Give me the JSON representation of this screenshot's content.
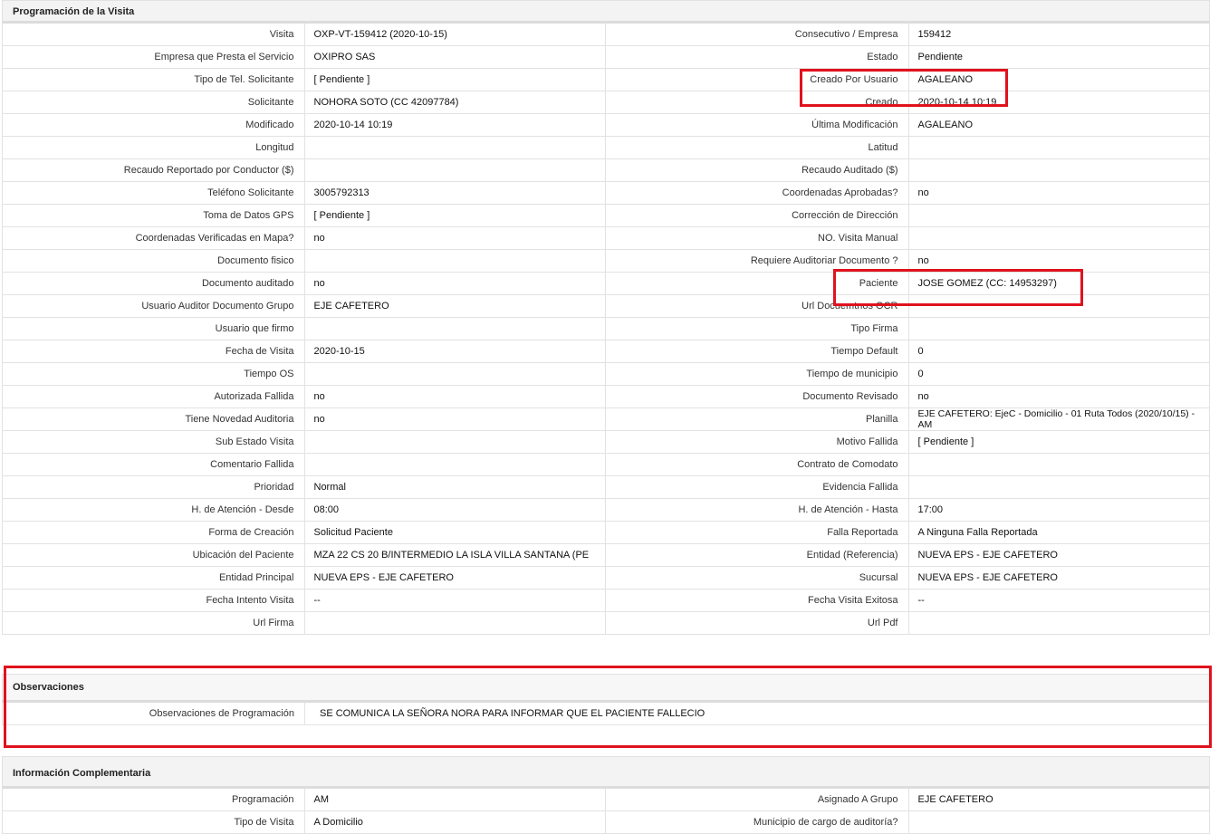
{
  "section1": {
    "title": "Programación de la Visita",
    "rows": [
      {
        "l1": "Visita",
        "v1": "OXP-VT-159412 (2020-10-15)",
        "l2": "Consecutivo / Empresa",
        "v2": "159412"
      },
      {
        "l1": "Empresa que Presta el Servicio",
        "v1": "OXIPRO SAS",
        "l2": "Estado",
        "v2": "Pendiente"
      },
      {
        "l1": "Tipo de Tel. Solicitante",
        "v1": "[ Pendiente ]",
        "l2": "Creado Por Usuario",
        "v2": "AGALEANO"
      },
      {
        "l1": "Solicitante",
        "v1": "NOHORA SOTO (CC 42097784)",
        "l2": "Creado",
        "v2": "2020-10-14 10:19"
      },
      {
        "l1": "Modificado",
        "v1": "2020-10-14 10:19",
        "l2": "Última Modificación",
        "v2": "AGALEANO"
      },
      {
        "l1": "Longitud",
        "v1": "",
        "l2": "Latitud",
        "v2": ""
      },
      {
        "l1": "Recaudo Reportado por Conductor ($)",
        "v1": "",
        "l2": "Recaudo Auditado ($)",
        "v2": ""
      },
      {
        "l1": "Teléfono Solicitante",
        "v1": "3005792313",
        "l2": "Coordenadas Aprobadas?",
        "v2": "no"
      },
      {
        "l1": "Toma de Datos GPS",
        "v1": "[ Pendiente ]",
        "l2": "Corrección de Dirección",
        "v2": ""
      },
      {
        "l1": "Coordenadas Verificadas en Mapa?",
        "v1": "no",
        "l2": "NO. Visita Manual",
        "v2": ""
      },
      {
        "l1": "Documento fisico",
        "v1": "",
        "l2": "Requiere Auditoriar Documento ?",
        "v2": "no"
      },
      {
        "l1": "Documento auditado",
        "v1": "no",
        "l2": "Paciente",
        "v2": "JOSE GOMEZ (CC: 14953297)"
      },
      {
        "l1": "Usuario Auditor Documento Grupo",
        "v1": "EJE CAFETERO",
        "l2": "Url Docuemtnos OCR",
        "v2": ""
      },
      {
        "l1": "Usuario que firmo",
        "v1": "",
        "l2": "Tipo Firma",
        "v2": ""
      },
      {
        "l1": "Fecha de Visita",
        "v1": "2020-10-15",
        "l2": "Tiempo Default",
        "v2": "0"
      },
      {
        "l1": "Tiempo OS",
        "v1": "",
        "l2": "Tiempo de municipio",
        "v2": "0"
      },
      {
        "l1": "Autorizada Fallida",
        "v1": "no",
        "l2": "Documento Revisado",
        "v2": "no"
      },
      {
        "l1": "Tiene Novedad Auditoria",
        "v1": "no",
        "l2": "Planilla",
        "v2": "EJE CAFETERO: EjeC - Domicilio - 01 Ruta Todos (2020/10/15) - AM"
      },
      {
        "l1": "Sub Estado Visita",
        "v1": "",
        "l2": "Motivo Fallida",
        "v2": "[ Pendiente ]"
      },
      {
        "l1": "Comentario Fallida",
        "v1": "",
        "l2": "Contrato de Comodato",
        "v2": ""
      },
      {
        "l1": "Prioridad",
        "v1": "Normal",
        "l2": "Evidencia Fallida",
        "v2": ""
      },
      {
        "l1": "H. de Atención - Desde",
        "v1": "08:00",
        "l2": "H. de Atención - Hasta",
        "v2": "17:00"
      },
      {
        "l1": "Forma de Creación",
        "v1": "Solicitud Paciente",
        "l2": "Falla Reportada",
        "v2": "A Ninguna Falla Reportada"
      },
      {
        "l1": "Ubicación del Paciente",
        "v1": "MZA 22 CS 20 B/INTERMEDIO LA ISLA VILLA SANTANA (PE",
        "l2": "Entidad (Referencia)",
        "v2": "NUEVA EPS - EJE CAFETERO"
      },
      {
        "l1": "Entidad Principal",
        "v1": "NUEVA EPS - EJE CAFETERO",
        "l2": "Sucursal",
        "v2": "NUEVA EPS - EJE CAFETERO"
      },
      {
        "l1": "Fecha Intento Visita",
        "v1": "--",
        "l2": "Fecha Visita Exitosa",
        "v2": "--"
      },
      {
        "l1": "Url Firma",
        "v1": "",
        "l2": "Url Pdf",
        "v2": ""
      }
    ]
  },
  "section2": {
    "title": "Observaciones",
    "label": "Observaciones de Programación",
    "value": "SE COMUNICA LA SEÑORA NORA PARA INFORMAR QUE EL PACIENTE FALLECIO"
  },
  "section3": {
    "title": "Información Complementaria",
    "rows": [
      {
        "l1": "Programación",
        "v1": "AM",
        "l2": "Asignado A Grupo",
        "v2": "EJE CAFETERO"
      },
      {
        "l1": "Tipo de Visita",
        "v1": "A Domicilio",
        "l2": "Municipio de cargo de auditoría?",
        "v2": ""
      }
    ]
  },
  "colors": {
    "highlight": "#e0121d",
    "header_bg": "#f3f3f3",
    "border": "#e2e2e2"
  }
}
